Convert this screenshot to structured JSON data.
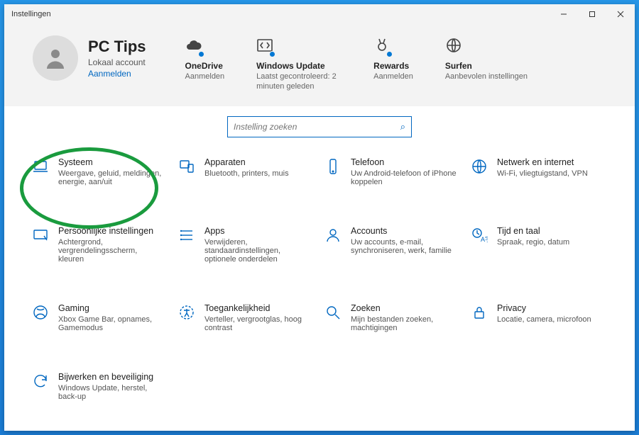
{
  "window": {
    "title": "Instellingen"
  },
  "profile": {
    "name": "PC Tips",
    "account_type": "Lokaal account",
    "signin": "Aanmelden"
  },
  "quick": {
    "onedrive": {
      "title": "OneDrive",
      "sub": "Aanmelden"
    },
    "update": {
      "title": "Windows Update",
      "sub": "Laatst gecontroleerd: 2 minuten geleden"
    },
    "rewards": {
      "title": "Rewards",
      "sub": "Aanmelden"
    },
    "surfen": {
      "title": "Surfen",
      "sub": "Aanbevolen instellingen"
    }
  },
  "search": {
    "placeholder": "Instelling zoeken"
  },
  "cats": {
    "systeem": {
      "title": "Systeem",
      "sub": "Weergave, geluid, meldingen, energie, aan/uit"
    },
    "apparaten": {
      "title": "Apparaten",
      "sub": "Bluetooth, printers, muis"
    },
    "telefoon": {
      "title": "Telefoon",
      "sub": "Uw Android-telefoon of iPhone koppelen"
    },
    "netwerk": {
      "title": "Netwerk en internet",
      "sub": "Wi-Fi, vliegtuigstand, VPN"
    },
    "personal": {
      "title": "Persoonlijke instellingen",
      "sub": "Achtergrond, vergrendelingsscherm, kleuren"
    },
    "apps": {
      "title": "Apps",
      "sub": "Verwijderen, standaardinstellingen, optionele onderdelen"
    },
    "accounts": {
      "title": "Accounts",
      "sub": "Uw accounts, e-mail, synchroniseren, werk, familie"
    },
    "tijd": {
      "title": "Tijd en taal",
      "sub": "Spraak, regio, datum"
    },
    "gaming": {
      "title": "Gaming",
      "sub": "Xbox Game Bar, opnames, Gamemodus"
    },
    "toegang": {
      "title": "Toegankelijkheid",
      "sub": "Verteller, vergrootglas, hoog contrast"
    },
    "zoeken": {
      "title": "Zoeken",
      "sub": "Mijn bestanden zoeken, machtigingen"
    },
    "privacy": {
      "title": "Privacy",
      "sub": "Locatie, camera, microfoon"
    },
    "bijwerken": {
      "title": "Bijwerken en beveiliging",
      "sub": "Windows Update, herstel, back-up"
    }
  }
}
